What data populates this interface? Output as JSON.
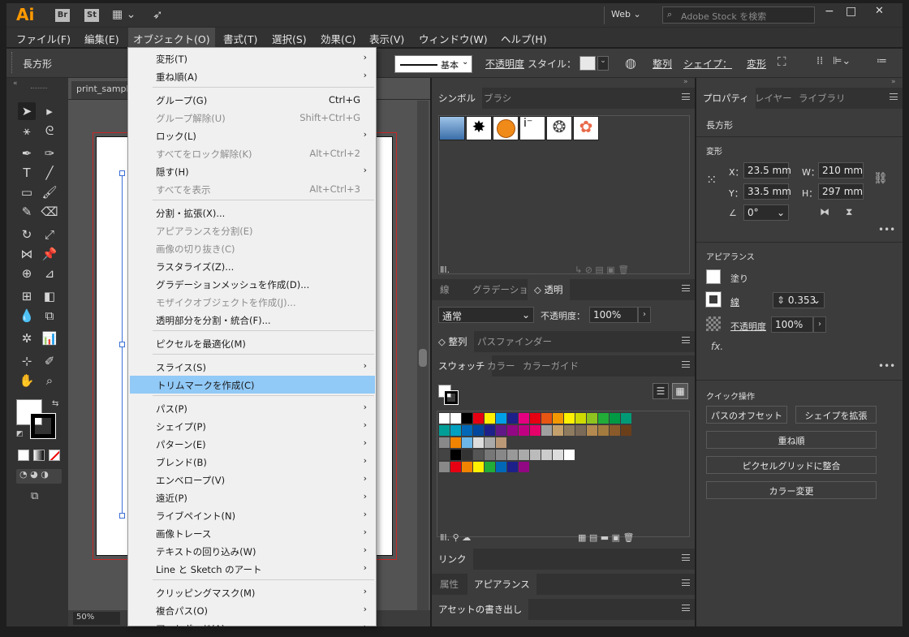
{
  "app": {
    "logo": "Ai",
    "br": "Br",
    "st": "St",
    "workspace": "Web",
    "search_placeholder": "Adobe Stock を検索",
    "window_min": "−",
    "window_max": "□",
    "window_close": "✕"
  },
  "menubar": [
    "ファイル(F)",
    "編集(E)",
    "オブジェクト(O)",
    "書式(T)",
    "選択(S)",
    "効果(C)",
    "表示(V)",
    "ウィンドウ(W)",
    "ヘルプ(H)"
  ],
  "control": {
    "shape_label": "長方形",
    "stroke_style": "基本",
    "opacity_label": "不透明度",
    "style_label": "スタイル：",
    "align": "整列",
    "shape": "シェイプ：",
    "transform": "変形"
  },
  "document": {
    "tab": "print_sample",
    "zoom": "50%"
  },
  "object_menu": [
    {
      "label": "変形(T)",
      "shortcut": "",
      "sub": true,
      "disabled": false
    },
    {
      "label": "重ね順(A)",
      "shortcut": "",
      "sub": true,
      "disabled": false
    },
    {
      "label": "グループ(G)",
      "shortcut": "Ctrl+G",
      "sub": false,
      "disabled": false
    },
    {
      "label": "グループ解除(U)",
      "shortcut": "Shift+Ctrl+G",
      "sub": false,
      "disabled": true
    },
    {
      "label": "ロック(L)",
      "shortcut": "",
      "sub": true,
      "disabled": false
    },
    {
      "label": "すべてをロック解除(K)",
      "shortcut": "Alt+Ctrl+2",
      "sub": false,
      "disabled": true
    },
    {
      "label": "隠す(H)",
      "shortcut": "",
      "sub": true,
      "disabled": false
    },
    {
      "label": "すべてを表示",
      "shortcut": "Alt+Ctrl+3",
      "sub": false,
      "disabled": true
    },
    {
      "label": "分割・拡張(X)...",
      "shortcut": "",
      "sub": false,
      "disabled": false
    },
    {
      "label": "アピアランスを分割(E)",
      "shortcut": "",
      "sub": false,
      "disabled": true
    },
    {
      "label": "画像の切り抜き(C)",
      "shortcut": "",
      "sub": false,
      "disabled": true
    },
    {
      "label": "ラスタライズ(Z)...",
      "shortcut": "",
      "sub": false,
      "disabled": false
    },
    {
      "label": "グラデーションメッシュを作成(D)...",
      "shortcut": "",
      "sub": false,
      "disabled": false
    },
    {
      "label": "モザイクオブジェクトを作成(J)...",
      "shortcut": "",
      "sub": false,
      "disabled": true
    },
    {
      "label": "透明部分を分割・統合(F)...",
      "shortcut": "",
      "sub": false,
      "disabled": false
    },
    {
      "label": "ピクセルを最適化(M)",
      "shortcut": "",
      "sub": false,
      "disabled": false
    },
    {
      "label": "スライス(S)",
      "shortcut": "",
      "sub": true,
      "disabled": false
    },
    {
      "label": "トリムマークを作成(C)",
      "shortcut": "",
      "sub": false,
      "disabled": false,
      "highlight": true
    },
    {
      "label": "パス(P)",
      "shortcut": "",
      "sub": true,
      "disabled": false
    },
    {
      "label": "シェイプ(P)",
      "shortcut": "",
      "sub": true,
      "disabled": false
    },
    {
      "label": "パターン(E)",
      "shortcut": "",
      "sub": true,
      "disabled": false
    },
    {
      "label": "ブレンド(B)",
      "shortcut": "",
      "sub": true,
      "disabled": false
    },
    {
      "label": "エンベロープ(V)",
      "shortcut": "",
      "sub": true,
      "disabled": false
    },
    {
      "label": "遠近(P)",
      "shortcut": "",
      "sub": true,
      "disabled": false
    },
    {
      "label": "ライブペイント(N)",
      "shortcut": "",
      "sub": true,
      "disabled": false
    },
    {
      "label": "画像トレース",
      "shortcut": "",
      "sub": true,
      "disabled": false
    },
    {
      "label": "テキストの回り込み(W)",
      "shortcut": "",
      "sub": true,
      "disabled": false
    },
    {
      "label": "Line と Sketch のアート",
      "shortcut": "",
      "sub": true,
      "disabled": false
    },
    {
      "label": "クリッピングマスク(M)",
      "shortcut": "",
      "sub": true,
      "disabled": false
    },
    {
      "label": "複合パス(O)",
      "shortcut": "",
      "sub": true,
      "disabled": false
    },
    {
      "label": "アートボード(A)",
      "shortcut": "",
      "sub": true,
      "disabled": false
    }
  ],
  "mid": {
    "symbols_tabs": [
      "シンボル",
      "ブラシ"
    ],
    "transp_tabs": [
      "線",
      "グラデーション",
      "◇ 透明"
    ],
    "blend_mode": "通常",
    "opacity_label": "不透明度：",
    "opacity_value": "100%",
    "align_tabs": [
      "◇ 整列",
      "パスファインダー"
    ],
    "swatch_tabs": [
      "スウォッチ",
      "カラー",
      "カラーガイド"
    ],
    "links_tab": "リンク",
    "attr_tabs": [
      "属性",
      "アピアランス"
    ],
    "asset_tab": "アセットの書き出し"
  },
  "right": {
    "tabs": [
      "プロパティ",
      "レイヤー",
      "ライブラリ"
    ],
    "object_type": "長方形",
    "transform_title": "変形",
    "x_label": "X：",
    "x": "23.5 mm",
    "w_label": "W：",
    "w": "210 mm",
    "y_label": "Y：",
    "y": "33.5 mm",
    "h_label": "H：",
    "h": "297 mm",
    "angle": "0°",
    "appearance_title": "アピアランス",
    "fill_label": "塗り",
    "stroke_label": "線",
    "stroke_value": "0.353",
    "opacity_label": "不透明度",
    "opacity_value": "100%",
    "fx": "fx.",
    "quick_title": "クイック操作",
    "btn_offset": "パスのオフセット",
    "btn_expand": "シェイプを拡張",
    "btn_arrange": "重ね順",
    "btn_pixel": "ピクセルグリッドに整合",
    "btn_recolor": "カラー変更"
  }
}
